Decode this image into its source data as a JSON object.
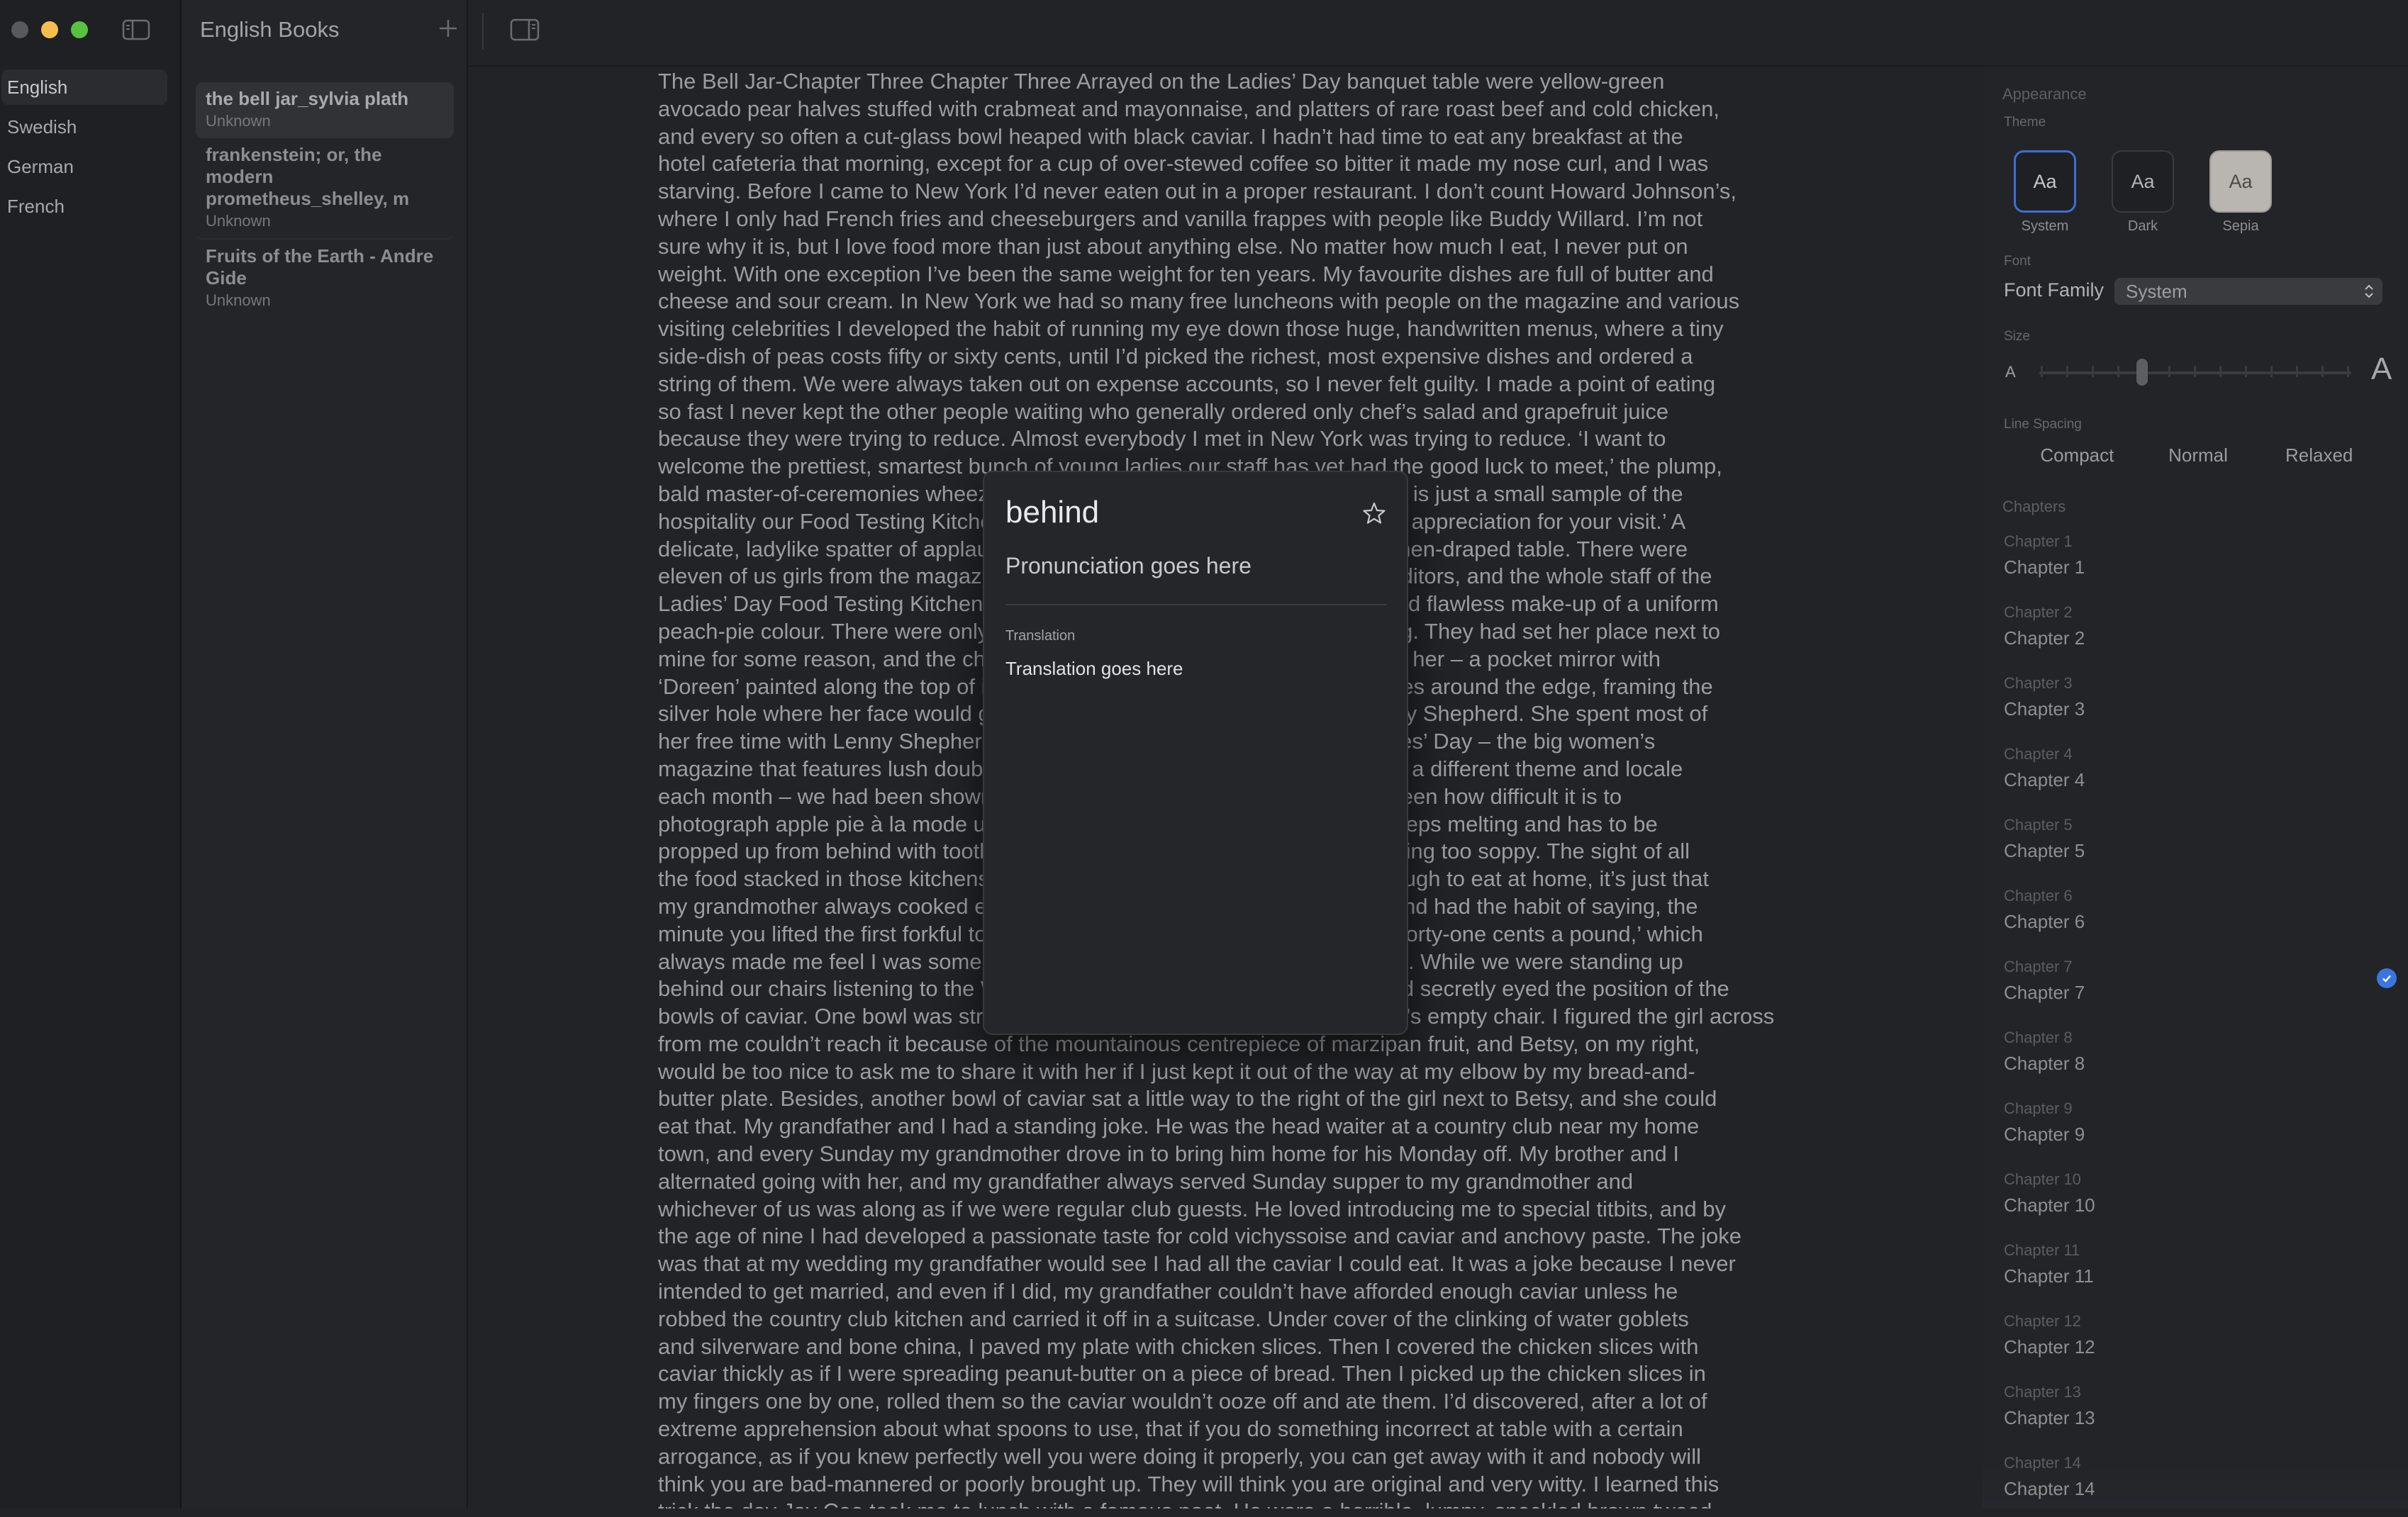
{
  "sidebar": {
    "languages": [
      {
        "label": "English"
      },
      {
        "label": "Swedish"
      },
      {
        "label": "German"
      },
      {
        "label": "French"
      }
    ]
  },
  "booklist": {
    "title": "English Books",
    "books": [
      {
        "title": "the bell jar_sylvia plath",
        "author": "Unknown"
      },
      {
        "title": "frankenstein; or, the modern prometheus_shelley, m",
        "author": "Unknown"
      },
      {
        "title": "Fruits of the Earth - Andre Gide",
        "author": "Unknown"
      }
    ]
  },
  "reader": {
    "lines": [
      "The Bell Jar-Chapter Three Chapter Three Arrayed on the Ladies’ Day banquet table were yellow-green",
      "avocado pear halves stuffed with crabmeat and mayonnaise, and platters of rare roast beef and cold chicken,",
      "and every so often a cut-glass bowl heaped with black caviar. I hadn’t had time to eat any breakfast at the",
      "hotel cafeteria that morning, except for a cup of over-stewed coffee so bitter it made my nose curl, and I was",
      "starving. Before I came to New York I’d never eaten out in a proper restaurant. I don’t count Howard Johnson’s,",
      "where I only had French fries and cheeseburgers and vanilla frappes with people like Buddy Willard. I’m not",
      "sure why it is, but I love food more than just about anything else. No matter how much I eat, I never put on",
      "weight. With one exception I’ve been the same weight for ten years. My favourite dishes are full of butter and",
      "cheese and sour cream. In New York we had so many free luncheons with people on the magazine and various",
      "visiting celebrities I developed the habit of running my eye down those huge, handwritten menus, where a tiny",
      "side-dish of peas costs fifty or sixty cents, until I’d picked the richest, most expensive dishes and ordered a",
      "string of them. We were always taken out on expense accounts, so I never felt guilty. I made a point of eating",
      "so fast I never kept the other people waiting who generally ordered only chef’s salad and grapefruit juice",
      "because they were trying to reduce. Almost everybody I met in New York was trying to reduce. ‘I want to",
      "welcome the prettiest, smartest bunch of young ladies our staff has yet had the good luck to meet,’ the plump,",
      "bald master-of-ceremonies wheezed into his lapel microphone. ‘This banquet is just a small sample of the",
      "hospitality our Food Testing Kitchen here on Ladies’ Day would like to offer in appreciation for your visit.’ A",
      "delicate, ladylike spatter of applause, and we all sat down at the enormous linen-draped table. There were",
      "eleven of us girls from the magazine, together with most of our supervising editors, and the whole staff of the",
      "Ladies’ Day Food Testing Kitchen in hygienic white smocks, neat hair-nets and flawless make-up of a uniform",
      "peach-pie colour. There were only eleven of us, because Doreen was missing. They had set her place next to",
      "mine for some reason, and the chair stayed empty. I saved her place-card for her – a pocket mirror with",
      "‘Doreen’ painted along the top of it in lacy script and a wreath of frosted daisies around the edge, framing the",
      "silver hole where her face would go. Doreen was spending the day with Lenny Shepherd. She spent most of",
      "her free time with Lenny Shepherd now. An hour before the luncheon at Ladies’ Day – the big women’s",
      "magazine that features lush double-page spreads of technicolour meals, with a different theme and locale",
      "each month – we had been shown around the endless glossy kitchens and seen how difficult it is to",
      "photograph apple pie à la mode under bright lights because the ice-cream keeps melting and has to be",
      "propped up from behind with toothpicks and changed every time it starts looking too soppy. The sight of all",
      "the food stacked in those kitchens made me dizzy. It’s not that we hadn’t enough to eat at home, it’s just that",
      "my grandmother always cooked economy joints and economy meat-loaves and had the habit of saying, the",
      "minute you lifted the first forkful to your mouth, ‘I hope you enjoy that, it cost forty-one cents a pound,’ which",
      "always made me feel I was somehow eating pennies instead of Sunday roast. While we were standing up",
      "behind our chairs listening to the Welcome speech, I had bowed my head and secretly eyed the position of the",
      "bowls of caviar. One bowl was strategically set right between me and Doreen’s empty chair. I figured the girl across",
      "from me couldn’t reach it because of the mountainous centrepiece of marzipan fruit, and Betsy, on my right,",
      "would be too nice to ask me to share it with her if I just kept it out of the way at my elbow by my bread-and-",
      "butter plate. Besides, another bowl of caviar sat a little way to the right of the girl next to Betsy, and she could",
      "eat that. My grandfather and I had a standing joke. He was the head waiter at a country club near my home",
      "town, and every Sunday my grandmother drove in to bring him home for his Monday off. My brother and I",
      "alternated going with her, and my grandfather always served Sunday supper to my grandmother and",
      "whichever of us was along as if we were regular club guests. He loved introducing me to special titbits, and by",
      "the age of nine I had developed a passionate taste for cold vichyssoise and caviar and anchovy paste. The joke",
      "was that at my wedding my grandfather would see I had all the caviar I could eat. It was a joke because I never",
      "intended to get married, and even if I did, my grandfather couldn’t have afforded enough caviar unless he",
      "robbed the country club kitchen and carried it off in a suitcase. Under cover of the clinking of water goblets",
      "and silverware and bone china, I paved my plate with chicken slices. Then I covered the chicken slices with",
      "caviar thickly as if I were spreading peanut-butter on a piece of bread. Then I picked up the chicken slices in",
      "my fingers one by one, rolled them so the caviar wouldn’t ooze off and ate them. I’d discovered, after a lot of",
      "extreme apprehension about what spoons to use, that if you do something incorrect at table with a certain",
      "arrogance, as if you knew perfectly well you were doing it properly, you can get away with it and nobody will",
      "think you are bad-mannered or poorly brought up. They will think you are original and very witty. I learned this",
      "trick the day Jay Cee took me to lunch with a famous poet. He wore a horrible, lumpy, speckled brown tweed"
    ]
  },
  "popup": {
    "word": "behind",
    "pronunciation": "Pronunciation goes here",
    "translation_label": "Translation",
    "translation": "Translation goes here"
  },
  "inspector": {
    "appearance_label": "Appearance",
    "theme_label": "Theme",
    "themes": [
      {
        "swatch": "Aa",
        "name": "System"
      },
      {
        "swatch": "Aa",
        "name": "Dark"
      },
      {
        "swatch": "Aa",
        "name": "Sepia"
      }
    ],
    "selected_theme": "System",
    "font_label": "Font",
    "font_family_label": "Font Family",
    "font_family_value": "System",
    "size_label": "Size",
    "size_small": "A",
    "size_large": "A",
    "size_level": 0.33,
    "line_spacing_label": "Line Spacing",
    "line_spacing_options": [
      "Compact",
      "Normal",
      "Relaxed"
    ],
    "chapters_label": "Chapters",
    "chapters": [
      {
        "small": "Chapter 1",
        "title": "Chapter 1"
      },
      {
        "small": "Chapter 2",
        "title": "Chapter 2"
      },
      {
        "small": "Chapter 3",
        "title": "Chapter 3"
      },
      {
        "small": "Chapter 4",
        "title": "Chapter 4"
      },
      {
        "small": "Chapter 5",
        "title": "Chapter 5"
      },
      {
        "small": "Chapter 6",
        "title": "Chapter 6"
      },
      {
        "small": "Chapter 7",
        "title": "Chapter 7"
      },
      {
        "small": "Chapter 8",
        "title": "Chapter 8"
      },
      {
        "small": "Chapter 9",
        "title": "Chapter 9"
      },
      {
        "small": "Chapter 10",
        "title": "Chapter 10"
      },
      {
        "small": "Chapter 11",
        "title": "Chapter 11"
      },
      {
        "small": "Chapter 12",
        "title": "Chapter 12"
      },
      {
        "small": "Chapter 13",
        "title": "Chapter 13"
      },
      {
        "small": "Chapter 14",
        "title": "Chapter 14"
      }
    ],
    "current_chapter": "Chapter 7"
  },
  "colors": {
    "accent": "#3a76e0",
    "background": "#222326"
  }
}
